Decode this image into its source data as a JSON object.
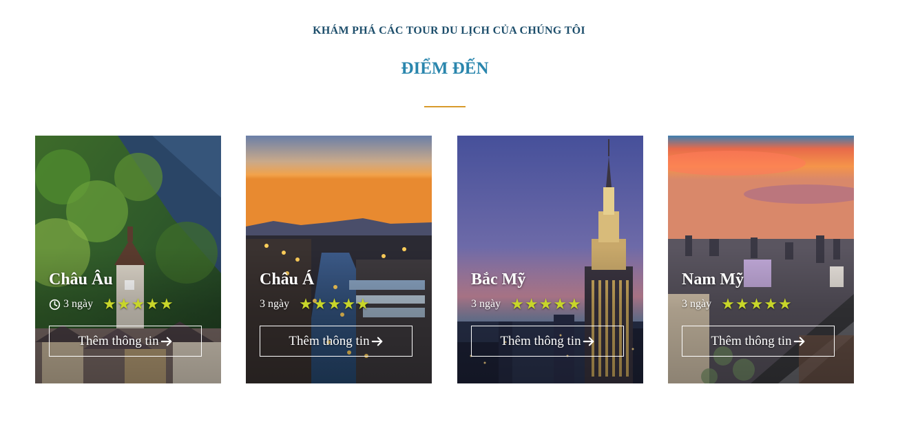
{
  "section": {
    "kicker": "KHÁM PHÁ CÁC TOUR DU LỊCH CỦA CHÚNG TÔI",
    "heading": "ĐIỂM ĐẾN"
  },
  "colors": {
    "kicker": "#1d4e6b",
    "heading": "#2a86ad",
    "divider": "#d89a2a",
    "star": "#c8d62a"
  },
  "cards": [
    {
      "title": "Châu Âu",
      "duration": "3 ngày",
      "rating": 5,
      "button": "Thêm thông tin",
      "image": "mountain-village-photo",
      "show_clock": true
    },
    {
      "title": "Châu Á",
      "duration": "3 ngày",
      "rating": 5,
      "button": "Thêm thông tin",
      "image": "lantern-river-town-photo",
      "show_clock": false
    },
    {
      "title": "Bắc Mỹ",
      "duration": "3 ngày",
      "rating": 5,
      "button": "Thêm thông tin",
      "image": "skyscraper-dusk-photo",
      "show_clock": false
    },
    {
      "title": "Nam Mỹ",
      "duration": "3 ngày",
      "rating": 5,
      "button": "Thêm thông tin",
      "image": "city-sunset-photo",
      "show_clock": false
    }
  ]
}
